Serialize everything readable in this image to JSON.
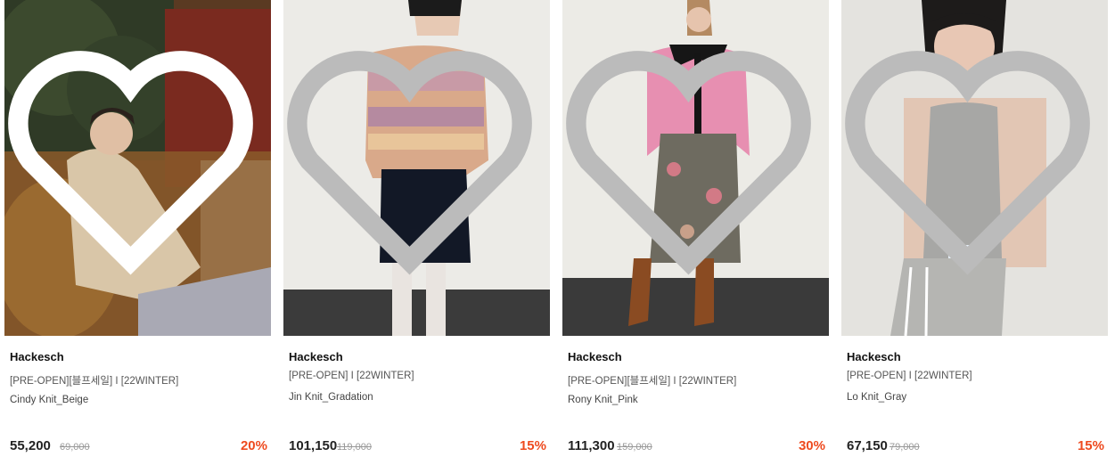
{
  "products": [
    {
      "brand": "Hackesch",
      "tag": "[PRE-OPEN][블프세일] I [22WINTER]",
      "name": "Cindy Knit_Beige",
      "price": "55,200",
      "original_price": "69,000",
      "discount": "20%",
      "image_alt": "model-on-sofa-beige-knit"
    },
    {
      "brand": "Hackesch",
      "tag": "[PRE-OPEN] I [22WINTER]",
      "name": "Jin Knit_Gradation",
      "price": "101,150",
      "original_price": "119,000",
      "discount": "15%",
      "image_alt": "model-gradation-knit-black-skirt"
    },
    {
      "brand": "Hackesch",
      "tag": "[PRE-OPEN][블프세일] I [22WINTER]",
      "name": "Rony Knit_Pink",
      "price": "111,300",
      "original_price": "159,000",
      "discount": "30%",
      "image_alt": "model-pink-knit-floral-skirt"
    },
    {
      "brand": "Hackesch",
      "tag": "[PRE-OPEN] I [22WINTER]",
      "name": "Lo Knit_Gray",
      "price": "67,150",
      "original_price": "79,000",
      "discount": "15%",
      "image_alt": "model-gray-knit-vest"
    }
  ],
  "colors": {
    "discount": "#ee4a1f",
    "price": "#222222",
    "original_price": "#999999"
  },
  "icons": {
    "wishlist": "heart-outline-icon"
  }
}
